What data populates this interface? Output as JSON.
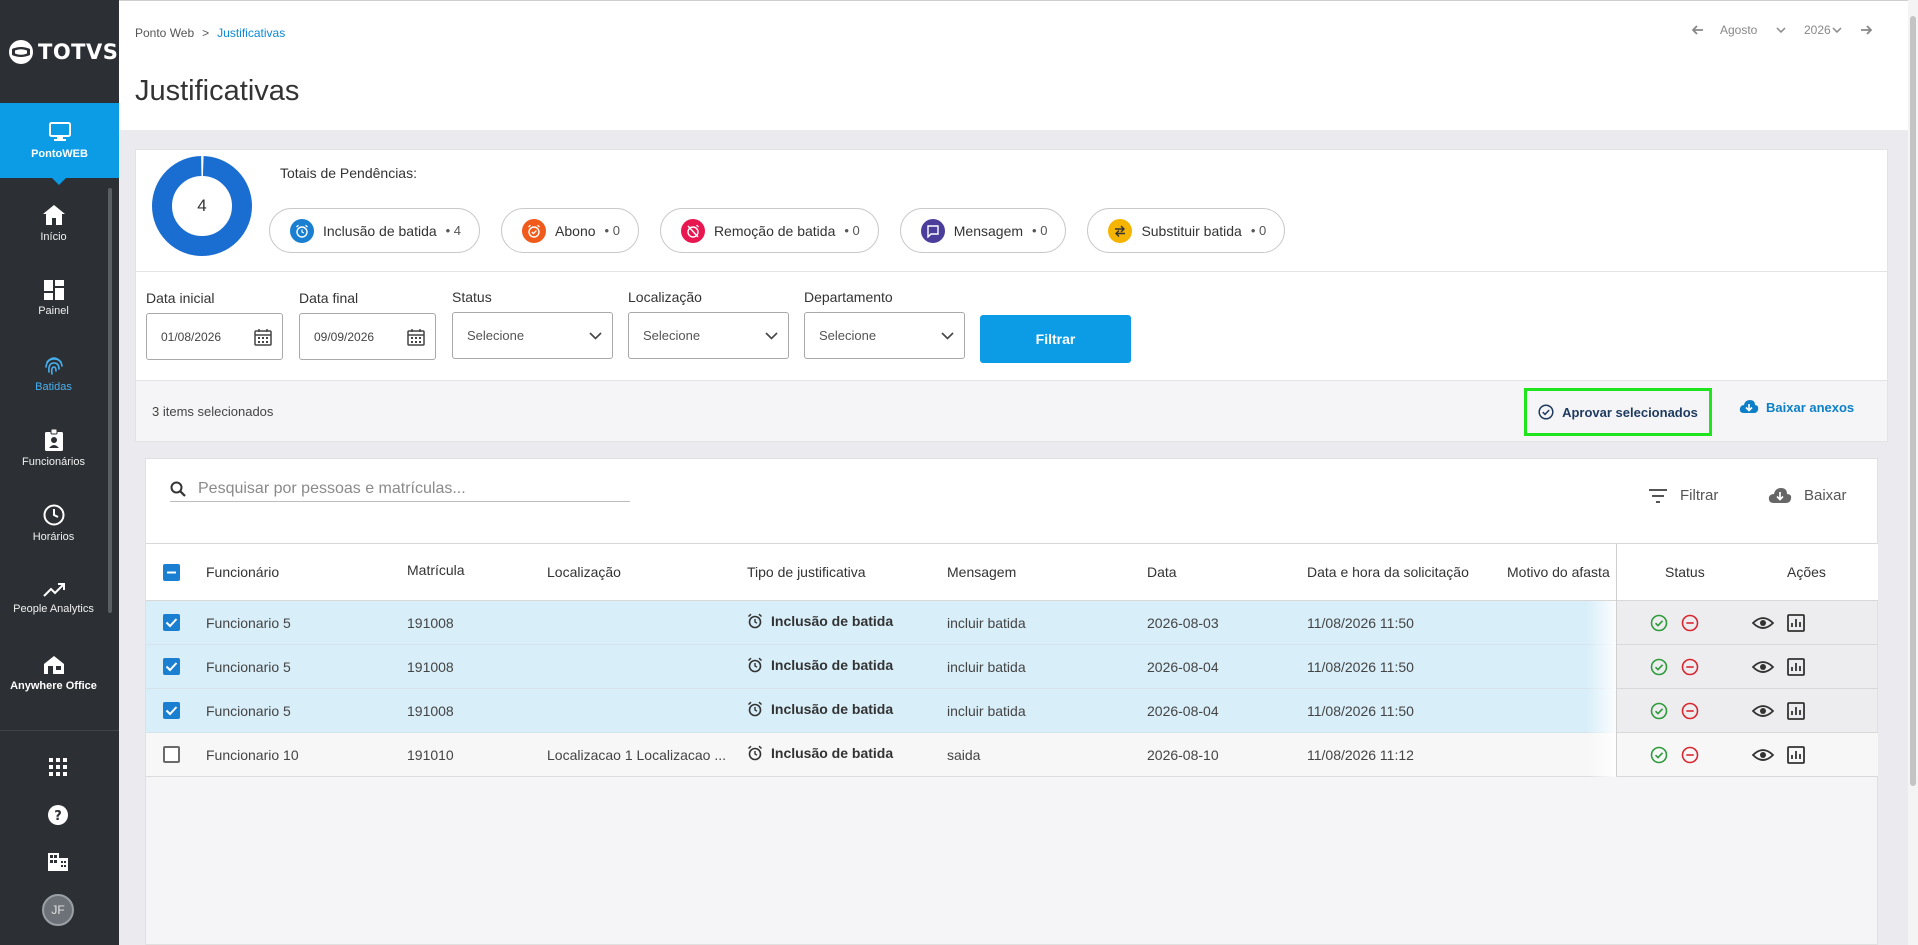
{
  "brand": {
    "name": "TOTVS"
  },
  "sidebar": {
    "active": {
      "label": "PontoWEB"
    },
    "items": [
      {
        "label": "Início"
      },
      {
        "label": "Painel"
      },
      {
        "label": "Batidas"
      },
      {
        "label": "Funcionários"
      },
      {
        "label": "Horários"
      },
      {
        "label": "People Analytics"
      },
      {
        "label": "Anywhere Office"
      }
    ],
    "user_initials": "JF"
  },
  "header": {
    "breadcrumb": {
      "root": "Ponto Web",
      "separator": ">",
      "current": "Justificativas"
    },
    "title": "Justificativas",
    "period": {
      "month": "Agosto",
      "year": "2026"
    }
  },
  "summary": {
    "total": "4",
    "totals_label": "Totais de Pendências:",
    "chips": [
      {
        "label": "Inclusão de batida",
        "count": "• 4",
        "color": "#1a7fd1"
      },
      {
        "label": "Abono",
        "count": "• 0",
        "color": "#f05a1a"
      },
      {
        "label": "Remoção de batida",
        "count": "• 0",
        "color": "#e8174f"
      },
      {
        "label": "Mensagem",
        "count": "• 0",
        "color": "#4a3e9a"
      },
      {
        "label": "Substituir batida",
        "count": "• 0",
        "color": "#f5b400"
      }
    ]
  },
  "filters": {
    "start_label": "Data inicial",
    "start_value": "01/08/2026",
    "end_label": "Data final",
    "end_value": "09/09/2026",
    "status_label": "Status",
    "status_value": "Selecione",
    "location_label": "Localização",
    "location_value": "Selecione",
    "department_label": "Departamento",
    "department_value": "Selecione",
    "submit_label": "Filtrar"
  },
  "selection": {
    "count_text": "3 items selecionados",
    "approve_label": "Aprovar selecionados",
    "download_label": "Baixar anexos"
  },
  "table": {
    "search_placeholder": "Pesquisar por pessoas e matrículas...",
    "filter_label": "Filtrar",
    "download_label": "Baixar",
    "columns": {
      "employee": "Funcionário",
      "registration": "Matrícula",
      "location": "Localização",
      "type": "Tipo de justificativa",
      "message": "Mensagem",
      "date": "Data",
      "requested_at": "Data e hora da solicitação",
      "reason": "Motivo do afasta",
      "status": "Status",
      "actions": "Ações"
    },
    "rows": [
      {
        "selected": true,
        "employee": "Funcionario 5",
        "registration": "191008",
        "location": "",
        "type": "Inclusão de batida",
        "message": "incluir batida",
        "date": "2026-08-03",
        "requested_at": "11/08/2026 11:50"
      },
      {
        "selected": true,
        "employee": "Funcionario 5",
        "registration": "191008",
        "location": "",
        "type": "Inclusão de batida",
        "message": "incluir batida",
        "date": "2026-08-04",
        "requested_at": "11/08/2026 11:50"
      },
      {
        "selected": true,
        "employee": "Funcionario 5",
        "registration": "191008",
        "location": "",
        "type": "Inclusão de batida",
        "message": "incluir batida",
        "date": "2026-08-04",
        "requested_at": "11/08/2026 11:50"
      },
      {
        "selected": false,
        "employee": "Funcionario 10",
        "registration": "191010",
        "location": "Localizacao 1 Localizacao ...",
        "type": "Inclusão de batida",
        "message": "saida",
        "date": "2026-08-10",
        "requested_at": "11/08/2026 11:12"
      }
    ]
  },
  "colors": {
    "accent": "#0c9ce6",
    "sidebar": "#2c3034",
    "approve_highlight": "#1ee51e"
  }
}
